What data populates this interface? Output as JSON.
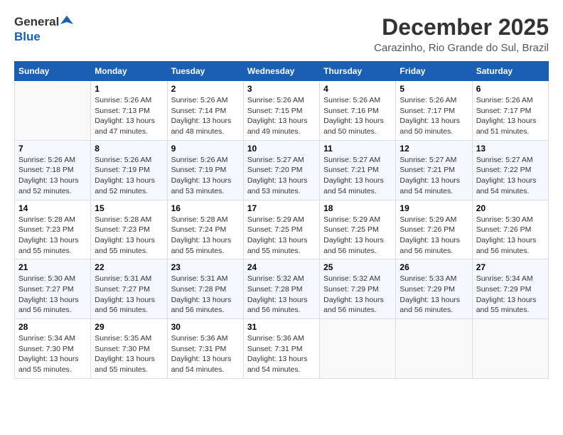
{
  "app": {
    "logo_general": "General",
    "logo_blue": "Blue",
    "month_title": "December 2025",
    "location": "Carazinho, Rio Grande do Sul, Brazil"
  },
  "calendar": {
    "headers": [
      "Sunday",
      "Monday",
      "Tuesday",
      "Wednesday",
      "Thursday",
      "Friday",
      "Saturday"
    ],
    "weeks": [
      [
        {
          "day": "",
          "info": ""
        },
        {
          "day": "1",
          "info": "Sunrise: 5:26 AM\nSunset: 7:13 PM\nDaylight: 13 hours\nand 47 minutes."
        },
        {
          "day": "2",
          "info": "Sunrise: 5:26 AM\nSunset: 7:14 PM\nDaylight: 13 hours\nand 48 minutes."
        },
        {
          "day": "3",
          "info": "Sunrise: 5:26 AM\nSunset: 7:15 PM\nDaylight: 13 hours\nand 49 minutes."
        },
        {
          "day": "4",
          "info": "Sunrise: 5:26 AM\nSunset: 7:16 PM\nDaylight: 13 hours\nand 50 minutes."
        },
        {
          "day": "5",
          "info": "Sunrise: 5:26 AM\nSunset: 7:17 PM\nDaylight: 13 hours\nand 50 minutes."
        },
        {
          "day": "6",
          "info": "Sunrise: 5:26 AM\nSunset: 7:17 PM\nDaylight: 13 hours\nand 51 minutes."
        }
      ],
      [
        {
          "day": "7",
          "info": "Sunrise: 5:26 AM\nSunset: 7:18 PM\nDaylight: 13 hours\nand 52 minutes."
        },
        {
          "day": "8",
          "info": "Sunrise: 5:26 AM\nSunset: 7:19 PM\nDaylight: 13 hours\nand 52 minutes."
        },
        {
          "day": "9",
          "info": "Sunrise: 5:26 AM\nSunset: 7:19 PM\nDaylight: 13 hours\nand 53 minutes."
        },
        {
          "day": "10",
          "info": "Sunrise: 5:27 AM\nSunset: 7:20 PM\nDaylight: 13 hours\nand 53 minutes."
        },
        {
          "day": "11",
          "info": "Sunrise: 5:27 AM\nSunset: 7:21 PM\nDaylight: 13 hours\nand 54 minutes."
        },
        {
          "day": "12",
          "info": "Sunrise: 5:27 AM\nSunset: 7:21 PM\nDaylight: 13 hours\nand 54 minutes."
        },
        {
          "day": "13",
          "info": "Sunrise: 5:27 AM\nSunset: 7:22 PM\nDaylight: 13 hours\nand 54 minutes."
        }
      ],
      [
        {
          "day": "14",
          "info": "Sunrise: 5:28 AM\nSunset: 7:23 PM\nDaylight: 13 hours\nand 55 minutes."
        },
        {
          "day": "15",
          "info": "Sunrise: 5:28 AM\nSunset: 7:23 PM\nDaylight: 13 hours\nand 55 minutes."
        },
        {
          "day": "16",
          "info": "Sunrise: 5:28 AM\nSunset: 7:24 PM\nDaylight: 13 hours\nand 55 minutes."
        },
        {
          "day": "17",
          "info": "Sunrise: 5:29 AM\nSunset: 7:25 PM\nDaylight: 13 hours\nand 55 minutes."
        },
        {
          "day": "18",
          "info": "Sunrise: 5:29 AM\nSunset: 7:25 PM\nDaylight: 13 hours\nand 56 minutes."
        },
        {
          "day": "19",
          "info": "Sunrise: 5:29 AM\nSunset: 7:26 PM\nDaylight: 13 hours\nand 56 minutes."
        },
        {
          "day": "20",
          "info": "Sunrise: 5:30 AM\nSunset: 7:26 PM\nDaylight: 13 hours\nand 56 minutes."
        }
      ],
      [
        {
          "day": "21",
          "info": "Sunrise: 5:30 AM\nSunset: 7:27 PM\nDaylight: 13 hours\nand 56 minutes."
        },
        {
          "day": "22",
          "info": "Sunrise: 5:31 AM\nSunset: 7:27 PM\nDaylight: 13 hours\nand 56 minutes."
        },
        {
          "day": "23",
          "info": "Sunrise: 5:31 AM\nSunset: 7:28 PM\nDaylight: 13 hours\nand 56 minutes."
        },
        {
          "day": "24",
          "info": "Sunrise: 5:32 AM\nSunset: 7:28 PM\nDaylight: 13 hours\nand 56 minutes."
        },
        {
          "day": "25",
          "info": "Sunrise: 5:32 AM\nSunset: 7:29 PM\nDaylight: 13 hours\nand 56 minutes."
        },
        {
          "day": "26",
          "info": "Sunrise: 5:33 AM\nSunset: 7:29 PM\nDaylight: 13 hours\nand 56 minutes."
        },
        {
          "day": "27",
          "info": "Sunrise: 5:34 AM\nSunset: 7:29 PM\nDaylight: 13 hours\nand 55 minutes."
        }
      ],
      [
        {
          "day": "28",
          "info": "Sunrise: 5:34 AM\nSunset: 7:30 PM\nDaylight: 13 hours\nand 55 minutes."
        },
        {
          "day": "29",
          "info": "Sunrise: 5:35 AM\nSunset: 7:30 PM\nDaylight: 13 hours\nand 55 minutes."
        },
        {
          "day": "30",
          "info": "Sunrise: 5:36 AM\nSunset: 7:31 PM\nDaylight: 13 hours\nand 54 minutes."
        },
        {
          "day": "31",
          "info": "Sunrise: 5:36 AM\nSunset: 7:31 PM\nDaylight: 13 hours\nand 54 minutes."
        },
        {
          "day": "",
          "info": ""
        },
        {
          "day": "",
          "info": ""
        },
        {
          "day": "",
          "info": ""
        }
      ]
    ]
  }
}
